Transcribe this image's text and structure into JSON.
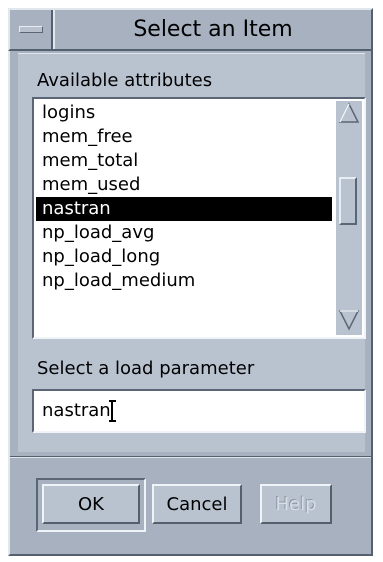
{
  "window": {
    "title": "Select an Item"
  },
  "attributes": {
    "label": "Available attributes",
    "items": [
      "logins",
      "mem_free",
      "mem_total",
      "mem_used",
      "nastran",
      "np_load_avg",
      "np_load_long",
      "np_load_medium"
    ],
    "selected_index": 4
  },
  "load_parameter": {
    "label": "Select a load parameter",
    "value": "nastran"
  },
  "buttons": {
    "ok": "OK",
    "cancel": "Cancel",
    "help": "Help"
  },
  "colors": {
    "frame": "#a7b1c0",
    "panel": "#b9c3d0",
    "selection": "#000000"
  }
}
